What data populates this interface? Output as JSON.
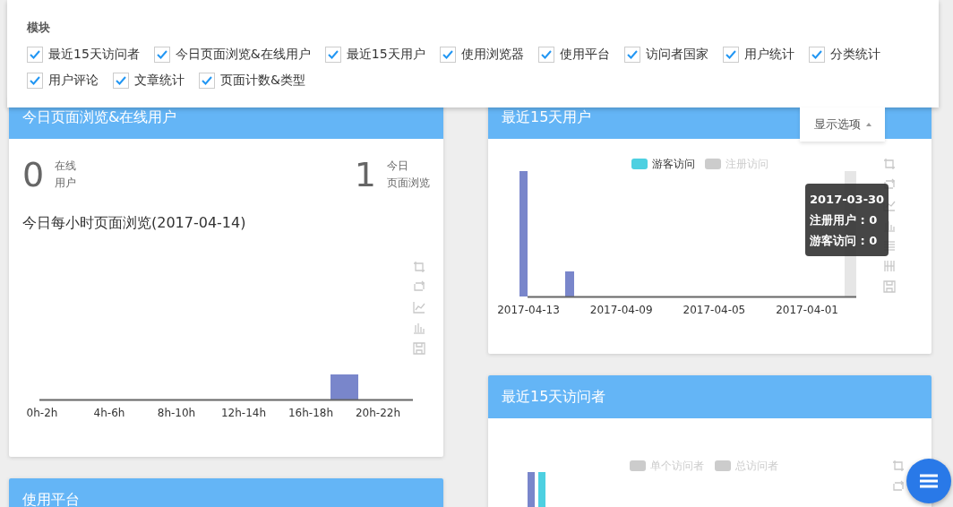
{
  "module_panel": {
    "heading": "模块",
    "modules": [
      {
        "label": "最近15天访问者",
        "checked": true
      },
      {
        "label": "今日页面浏览&在线用户",
        "checked": true
      },
      {
        "label": "最近15天用户",
        "checked": true
      },
      {
        "label": "使用浏览器",
        "checked": true
      },
      {
        "label": "使用平台",
        "checked": true
      },
      {
        "label": "访问者国家",
        "checked": true
      },
      {
        "label": "用户统计",
        "checked": true
      },
      {
        "label": "分类统计",
        "checked": true
      },
      {
        "label": "用户评论",
        "checked": true
      },
      {
        "label": "文章统计",
        "checked": true
      },
      {
        "label": "页面计数&类型",
        "checked": true
      }
    ]
  },
  "display_options": {
    "label": "显示选项",
    "expanded": true
  },
  "columns": [
    [
      {
        "kind": "today",
        "title": "今日页面浏览&在线用户",
        "stats": [
          {
            "value": "0",
            "label_lines": [
              "在线",
              "用户"
            ]
          },
          {
            "value": "1",
            "label_lines": [
              "今日",
              "页面浏览"
            ]
          }
        ],
        "subtitle": "今日每小时页面浏览(2017-04-14)",
        "axis_labels": [
          "0h-2h",
          "4h-6h",
          "8h-10h",
          "12h-14h",
          "16h-18h",
          "20h-22h"
        ]
      },
      {
        "kind": "header",
        "title": "使用平台"
      }
    ],
    [
      {
        "kind": "users",
        "title": "最近15天用户",
        "legend": [
          {
            "label": "游客访问",
            "color": "#4dd0e1",
            "on": true
          },
          {
            "label": "注册访问",
            "on": false
          }
        ],
        "axis_labels": [
          "2017-04-13",
          "2017-04-09",
          "2017-04-05",
          "2017-04-01"
        ],
        "tooltip": {
          "title": "2017-03-30",
          "lines": [
            "注册用户 : 0",
            "游客访问 : 0"
          ]
        }
      },
      {
        "kind": "visitors",
        "title": "最近15天访问者",
        "legend": [
          {
            "label": "单个访问者",
            "on": false
          },
          {
            "label": "总访问者",
            "on": false
          }
        ]
      }
    ]
  ]
}
